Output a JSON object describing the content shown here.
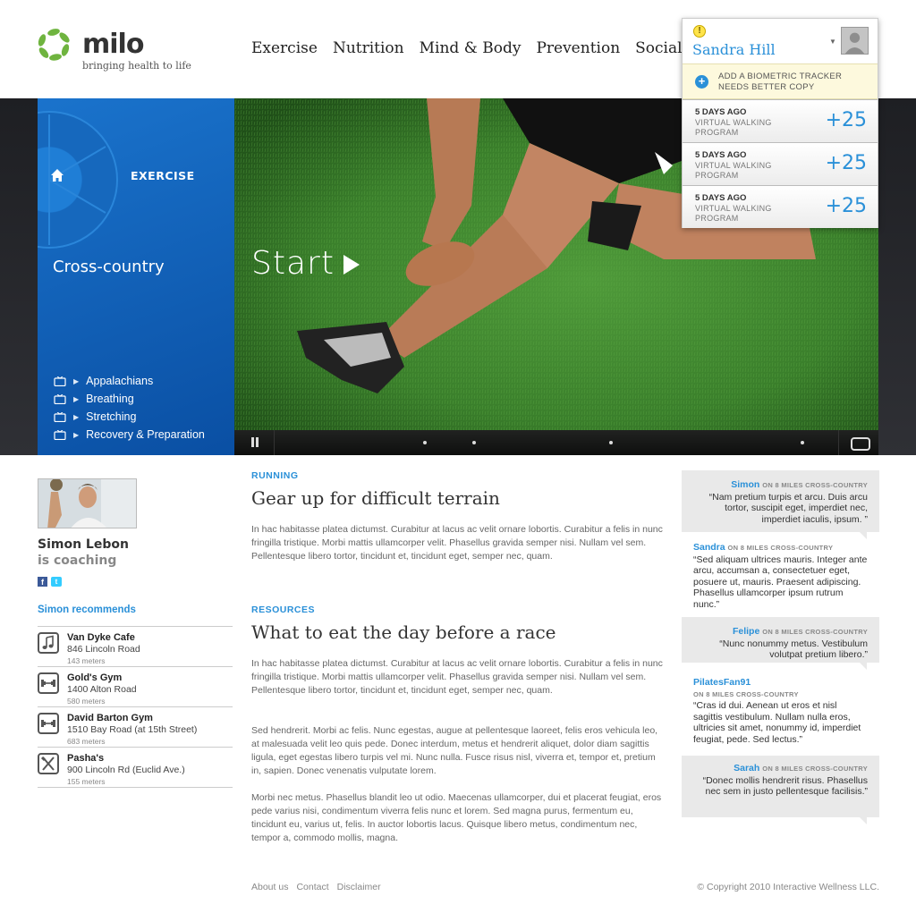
{
  "brand": {
    "name": "milo",
    "tagline": "bringing health to life"
  },
  "nav": [
    "Exercise",
    "Nutrition",
    "Mind & Body",
    "Prevention",
    "Social"
  ],
  "user": {
    "name": "Sandra Hill",
    "notice": "Add a biometric tracker needs better copy",
    "activities": [
      {
        "when": "5 days ago",
        "what": "Virtual walking program",
        "points": "+25"
      },
      {
        "when": "5 days ago",
        "what": "Virtual walking program",
        "points": "+25"
      },
      {
        "when": "5 days ago",
        "what": "Virtual walking program",
        "points": "+25"
      }
    ]
  },
  "hero": {
    "section": "EXERCISE",
    "title": "Cross-country",
    "items": [
      "Appalachians",
      "Breathing",
      "Stretching",
      "Recovery & Preparation"
    ],
    "start_label": "Start"
  },
  "coach": {
    "name": "Simon Lebon",
    "role": "is coaching",
    "recommends_title": "Simon recommends",
    "places": [
      {
        "icon": "music-icon",
        "name": "Van Dyke Cafe",
        "address": "846 Lincoln Road",
        "distance": "143 meters"
      },
      {
        "icon": "dumbbell-icon",
        "name": "Gold's Gym",
        "address": "1400 Alton Road",
        "distance": "580 meters"
      },
      {
        "icon": "dumbbell-icon",
        "name": "David Barton Gym",
        "address": "1510 Bay Road (at 15th Street)",
        "distance": "683 meters"
      },
      {
        "icon": "utensils-icon",
        "name": "Pasha's",
        "address": "900 Lincoln Rd (Euclid Ave.)",
        "distance": "155 meters"
      }
    ]
  },
  "articles": [
    {
      "label": "RUNNING",
      "title": "Gear up for difficult terrain",
      "paragraphs": [
        "In hac habitasse platea dictumst. Curabitur at lacus ac velit ornare lobortis. Curabitur a felis in nunc fringilla tristique. Morbi mattis ullamcorper velit. Phasellus gravida semper nisi. Nullam vel sem. Pellentesque libero tortor, tincidunt et, tincidunt eget, semper nec, quam."
      ]
    },
    {
      "label": "RESOURCES",
      "title": "What to eat the day before a race",
      "paragraphs": [
        "In hac habitasse platea dictumst. Curabitur at lacus ac velit ornare lobortis. Curabitur a felis in nunc fringilla tristique. Morbi mattis ullamcorper velit. Phasellus gravida semper nisi. Nullam vel sem. Pellentesque libero tortor, tincidunt et, tincidunt eget, semper nec, quam.",
        "Sed hendrerit. Morbi ac felis. Nunc egestas, augue at pellentesque laoreet, felis eros vehicula leo, at malesuada velit leo quis pede. Donec interdum, metus et hendrerit aliquet, dolor diam sagittis ligula, eget egestas libero turpis vel mi. Nunc nulla. Fusce risus nisl, viverra et, tempor et, pretium in, sapien. Donec venenatis vulputate lorem.",
        "Morbi nec metus. Phasellus blandit leo ut odio. Maecenas ullamcorper, dui et placerat feugiat, eros pede varius nisi, condimentum viverra felis nunc et lorem. Sed magna purus, fermentum eu, tincidunt eu, varius ut, felis. In auctor lobortis lacus. Quisque libero metus, condimentum nec, tempor a, commodo mollis, magna."
      ]
    }
  ],
  "comments": [
    {
      "user": "Simon",
      "on": "ON 8 MILES CROSS-COUNTRY",
      "text": "“Nam pretium turpis et arcu. Duis arcu tortor, suscipit eget, imperdiet nec, imperdiet iaculis, ipsum. ”"
    },
    {
      "user": "Sandra",
      "on": "ON 8 MILES CROSS-COUNTRY",
      "text": "“Sed aliquam ultrices mauris. Integer ante arcu, accumsan a, consectetuer eget, posuere ut, mauris. Praesent adipiscing. Phasellus ullamcorper ipsum rutrum nunc.”"
    },
    {
      "user": "Felipe",
      "on": "ON 8 MILES CROSS-COUNTRY",
      "text": "“Nunc nonummy metus. Vestibulum volutpat pretium libero.”"
    },
    {
      "user": "PilatesFan91",
      "on": "ON 8 MILES CROSS-COUNTRY",
      "text": "“Cras id dui. Aenean ut eros et nisl sagittis vestibulum. Nullam nulla eros, ultricies sit amet, nonummy id, imperdiet feugiat, pede. Sed lectus.”"
    },
    {
      "user": "Sarah",
      "on": "ON 8 MILES CROSS-COUNTRY",
      "text": "“Donec mollis hendrerit risus. Phasellus nec sem in justo pellentesque facilisis.”"
    }
  ],
  "footer": {
    "links": [
      "About us",
      "Contact",
      "Disclaimer"
    ],
    "copyright": "© Copyright 2010 Interactive Wellness LLC."
  }
}
